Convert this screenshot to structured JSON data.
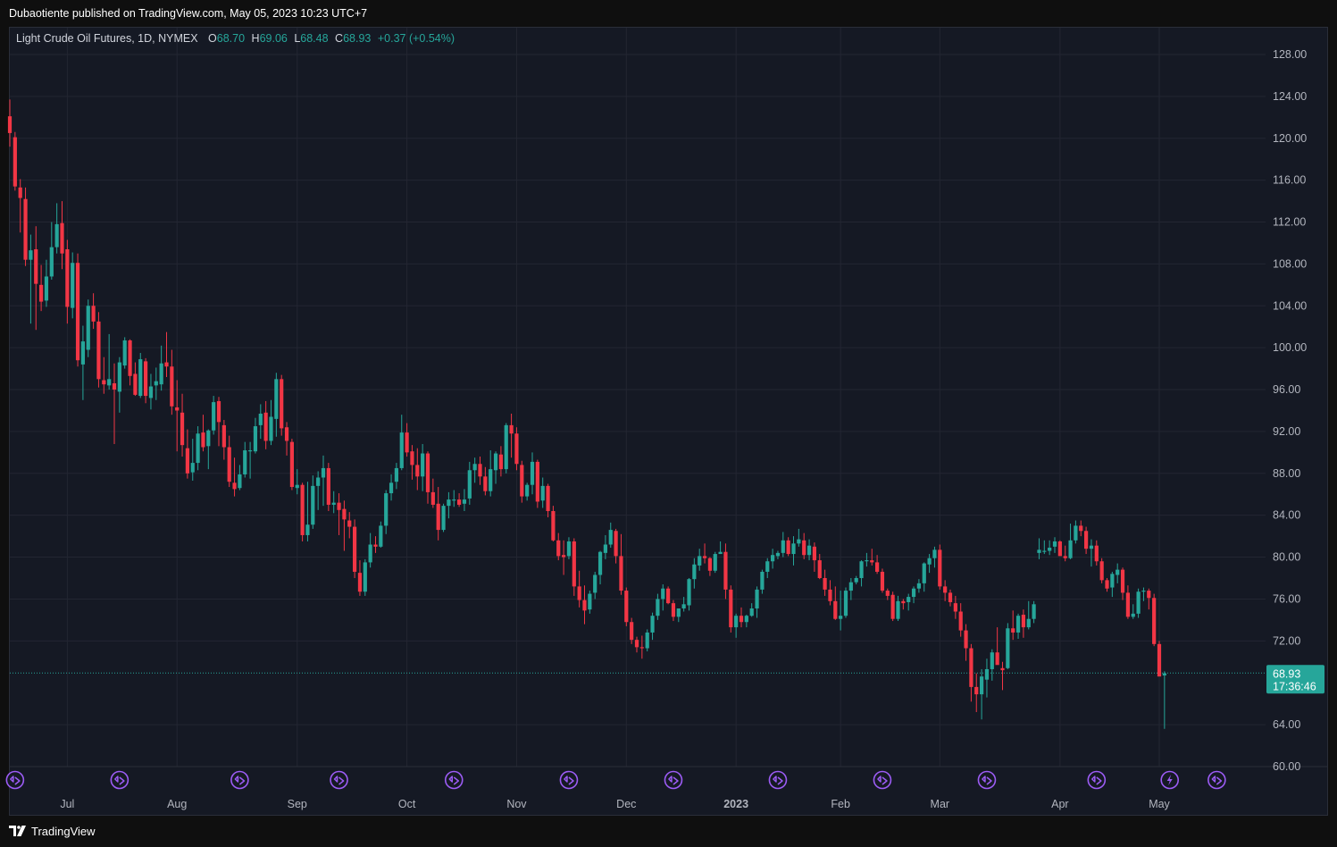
{
  "header": {
    "published_line": "Dubaotiente published on TradingView.com, May 05, 2023 10:23 UTC+7"
  },
  "legend": {
    "symbol": "Light Crude Oil Futures, 1D, NYMEX",
    "open_label": "O",
    "open": "68.70",
    "high_label": "H",
    "high": "69.06",
    "low_label": "L",
    "low": "68.48",
    "close_label": "C",
    "close": "68.93",
    "change": "+0.37 (+0.54%)"
  },
  "price_tag": {
    "price": "68.93",
    "countdown": "17:36:46"
  },
  "footer": {
    "brand": "TradingView"
  },
  "colors": {
    "up": "#26a69a",
    "down": "#f23645",
    "background": "#151924",
    "grid": "#232632",
    "axis_text": "#b2b5be",
    "event_icon": "#9c5cf5"
  },
  "icons": [
    "dividend-event-icon",
    "flash-event-icon",
    "tradingview-logo-icon"
  ],
  "chart_data": {
    "type": "candlestick",
    "title": "Light Crude Oil Futures, 1D, NYMEX",
    "xlabel": "",
    "ylabel": "",
    "ylim": [
      60,
      128
    ],
    "y_ticks": [
      "128.00",
      "124.00",
      "120.00",
      "116.00",
      "112.00",
      "108.00",
      "104.00",
      "100.00",
      "96.00",
      "92.00",
      "88.00",
      "84.00",
      "80.00",
      "76.00",
      "72.00",
      "64.00",
      "60.00"
    ],
    "x_ticks": [
      {
        "label": "Jul",
        "index": 11
      },
      {
        "label": "Aug",
        "index": 32
      },
      {
        "label": "Sep",
        "index": 55
      },
      {
        "label": "Oct",
        "index": 76
      },
      {
        "label": "Nov",
        "index": 97
      },
      {
        "label": "Dec",
        "index": 118
      },
      {
        "label": "2023",
        "index": 139
      },
      {
        "label": "Feb",
        "index": 159
      },
      {
        "label": "Mar",
        "index": 178
      },
      {
        "label": "Apr",
        "index": 201
      },
      {
        "label": "May",
        "index": 220
      }
    ],
    "grid": true,
    "last_price_line": 68.93,
    "ohlc": [
      [
        122.1,
        123.7,
        119.2,
        120.5
      ],
      [
        120.1,
        120.6,
        115.0,
        115.4
      ],
      [
        115.3,
        116.1,
        111.0,
        114.3
      ],
      [
        114.2,
        115.3,
        107.8,
        108.4
      ],
      [
        108.4,
        110.8,
        102.3,
        109.3
      ],
      [
        109.4,
        111.6,
        101.7,
        106.1
      ],
      [
        106.0,
        107.9,
        103.5,
        104.4
      ],
      [
        104.5,
        108.4,
        103.9,
        106.8
      ],
      [
        106.8,
        112.0,
        106.5,
        109.6
      ],
      [
        109.6,
        113.8,
        109.0,
        111.8
      ],
      [
        111.9,
        114.0,
        107.5,
        109.0
      ],
      [
        109.4,
        110.3,
        102.3,
        103.9
      ],
      [
        103.8,
        109.1,
        102.8,
        108.1
      ],
      [
        108.1,
        109.0,
        98.2,
        98.8
      ],
      [
        98.4,
        102.1,
        95.0,
        100.6
      ],
      [
        99.8,
        104.6,
        99.1,
        104.0
      ],
      [
        104.0,
        105.2,
        101.8,
        102.5
      ],
      [
        102.5,
        103.4,
        96.2,
        97.0
      ],
      [
        96.9,
        99.1,
        95.6,
        96.5
      ],
      [
        96.4,
        101.3,
        96.0,
        97.0
      ],
      [
        96.6,
        98.5,
        90.8,
        96.0
      ],
      [
        95.8,
        99.1,
        93.8,
        98.6
      ],
      [
        98.3,
        101.0,
        98.0,
        100.7
      ],
      [
        100.7,
        100.8,
        96.4,
        97.3
      ],
      [
        97.5,
        98.6,
        95.4,
        95.5
      ],
      [
        95.4,
        99.5,
        95.2,
        98.9
      ],
      [
        98.7,
        99.0,
        94.7,
        95.4
      ],
      [
        95.2,
        97.5,
        94.1,
        96.3
      ],
      [
        96.4,
        98.1,
        95.0,
        96.8
      ],
      [
        96.5,
        100.2,
        95.9,
        98.5
      ],
      [
        98.6,
        101.5,
        97.2,
        98.2
      ],
      [
        98.2,
        99.8,
        93.6,
        94.4
      ],
      [
        94.3,
        96.9,
        90.1,
        94.0
      ],
      [
        93.8,
        95.6,
        89.6,
        90.7
      ],
      [
        90.4,
        92.2,
        87.5,
        88.0
      ],
      [
        88.1,
        91.3,
        87.3,
        89.0
      ],
      [
        89.0,
        92.5,
        88.3,
        91.8
      ],
      [
        91.9,
        93.6,
        90.1,
        90.5
      ],
      [
        90.6,
        92.2,
        88.4,
        92.1
      ],
      [
        92.1,
        95.4,
        91.7,
        94.8
      ],
      [
        94.9,
        95.3,
        90.6,
        92.9
      ],
      [
        92.6,
        93.1,
        89.3,
        90.5
      ],
      [
        90.5,
        91.6,
        86.7,
        87.2
      ],
      [
        87.1,
        89.5,
        85.8,
        86.5
      ],
      [
        86.6,
        88.8,
        86.4,
        87.9
      ],
      [
        87.9,
        91.0,
        87.6,
        90.2
      ],
      [
        90.1,
        91.0,
        87.5,
        90.2
      ],
      [
        90.1,
        93.3,
        89.9,
        92.5
      ],
      [
        92.6,
        94.6,
        91.3,
        93.7
      ],
      [
        93.8,
        94.9,
        90.3,
        91.1
      ],
      [
        91.1,
        95.0,
        90.7,
        93.4
      ],
      [
        93.2,
        97.6,
        91.5,
        97.0
      ],
      [
        97.0,
        97.4,
        91.6,
        92.3
      ],
      [
        92.4,
        92.9,
        89.7,
        91.1
      ],
      [
        91.0,
        91.3,
        86.4,
        86.7
      ],
      [
        86.6,
        88.4,
        86.0,
        86.9
      ],
      [
        86.9,
        87.1,
        81.5,
        82.1
      ],
      [
        82.1,
        87.2,
        81.5,
        83.1
      ],
      [
        83.1,
        87.8,
        82.7,
        86.8
      ],
      [
        86.8,
        88.2,
        84.5,
        87.6
      ],
      [
        87.6,
        89.7,
        84.9,
        88.5
      ],
      [
        88.5,
        89.0,
        84.4,
        85.0
      ],
      [
        85.0,
        86.3,
        84.2,
        85.2
      ],
      [
        85.2,
        86.1,
        82.1,
        84.5
      ],
      [
        84.6,
        85.4,
        80.6,
        83.6
      ],
      [
        83.5,
        84.3,
        81.8,
        82.9
      ],
      [
        82.9,
        83.6,
        78.0,
        78.6
      ],
      [
        78.5,
        79.7,
        76.3,
        76.7
      ],
      [
        76.7,
        79.8,
        76.3,
        79.5
      ],
      [
        79.5,
        82.3,
        79.0,
        81.2
      ],
      [
        81.2,
        82.0,
        80.4,
        81.0
      ],
      [
        81.0,
        83.4,
        80.9,
        83.0
      ],
      [
        83.0,
        86.4,
        82.2,
        86.1
      ],
      [
        86.1,
        87.9,
        85.4,
        87.1
      ],
      [
        87.2,
        89.0,
        86.5,
        88.5
      ],
      [
        88.5,
        93.6,
        88.3,
        91.9
      ],
      [
        91.9,
        92.8,
        89.6,
        90.0
      ],
      [
        90.1,
        90.7,
        87.4,
        88.8
      ],
      [
        88.8,
        90.4,
        86.4,
        87.7
      ],
      [
        87.7,
        90.8,
        86.3,
        89.9
      ],
      [
        89.9,
        90.1,
        85.1,
        86.2
      ],
      [
        86.2,
        87.5,
        84.7,
        85.0
      ],
      [
        85.1,
        86.7,
        81.6,
        82.6
      ],
      [
        82.6,
        85.1,
        82.4,
        84.9
      ],
      [
        84.9,
        86.2,
        83.7,
        85.5
      ],
      [
        85.4,
        86.4,
        84.8,
        85.5
      ],
      [
        85.5,
        86.1,
        84.8,
        85.0
      ],
      [
        85.1,
        86.5,
        84.4,
        85.5
      ],
      [
        85.6,
        89.1,
        85.0,
        88.3
      ],
      [
        88.3,
        89.5,
        87.1,
        88.9
      ],
      [
        88.9,
        89.6,
        86.9,
        87.7
      ],
      [
        87.7,
        88.6,
        85.9,
        86.3
      ],
      [
        86.3,
        90.2,
        85.8,
        88.4
      ],
      [
        88.3,
        90.1,
        87.0,
        89.9
      ],
      [
        89.8,
        90.6,
        87.7,
        88.4
      ],
      [
        88.4,
        92.8,
        88.0,
        92.6
      ],
      [
        92.6,
        93.7,
        89.5,
        91.8
      ],
      [
        91.8,
        92.4,
        88.3,
        88.9
      ],
      [
        88.8,
        89.2,
        85.2,
        85.8
      ],
      [
        85.8,
        87.1,
        85.4,
        86.9
      ],
      [
        86.9,
        90.0,
        86.0,
        89.1
      ],
      [
        89.1,
        89.3,
        84.7,
        85.3
      ],
      [
        85.4,
        87.6,
        84.7,
        86.8
      ],
      [
        86.8,
        87.0,
        83.8,
        84.4
      ],
      [
        84.4,
        84.9,
        81.5,
        81.6
      ],
      [
        81.6,
        82.3,
        79.7,
        80.1
      ],
      [
        80.2,
        81.6,
        78.3,
        80.0
      ],
      [
        80.1,
        81.9,
        79.8,
        81.5
      ],
      [
        81.5,
        81.8,
        76.3,
        77.2
      ],
      [
        77.2,
        78.7,
        75.2,
        75.9
      ],
      [
        75.9,
        77.3,
        73.6,
        74.9
      ],
      [
        75.0,
        76.8,
        74.6,
        76.5
      ],
      [
        76.6,
        78.6,
        76.0,
        78.3
      ],
      [
        78.3,
        80.6,
        77.4,
        80.5
      ],
      [
        80.4,
        82.1,
        79.8,
        81.2
      ],
      [
        81.2,
        83.3,
        80.9,
        82.6
      ],
      [
        82.5,
        82.7,
        79.4,
        80.1
      ],
      [
        80.1,
        82.2,
        76.4,
        76.8
      ],
      [
        76.8,
        77.1,
        73.4,
        73.8
      ],
      [
        73.8,
        74.2,
        71.7,
        72.1
      ],
      [
        72.1,
        72.4,
        70.9,
        71.4
      ],
      [
        71.4,
        72.5,
        70.3,
        71.3
      ],
      [
        71.3,
        73.1,
        71.0,
        72.8
      ],
      [
        72.8,
        74.7,
        72.1,
        74.4
      ],
      [
        74.4,
        76.5,
        74.0,
        76.0
      ],
      [
        76.0,
        77.4,
        74.9,
        77.0
      ],
      [
        77.0,
        77.2,
        75.5,
        75.6
      ],
      [
        75.6,
        75.9,
        73.9,
        74.3
      ],
      [
        74.3,
        75.1,
        73.8,
        75.1
      ],
      [
        75.1,
        76.2,
        74.8,
        75.5
      ],
      [
        75.4,
        78.0,
        74.9,
        77.9
      ],
      [
        77.9,
        79.9,
        77.0,
        79.3
      ],
      [
        79.2,
        80.8,
        78.7,
        80.1
      ],
      [
        80.1,
        81.3,
        79.4,
        79.9
      ],
      [
        79.9,
        80.0,
        78.2,
        78.7
      ],
      [
        78.7,
        80.5,
        78.5,
        80.3
      ],
      [
        80.3,
        81.5,
        80.3,
        80.5
      ],
      [
        80.5,
        81.3,
        76.0,
        76.9
      ],
      [
        76.9,
        77.3,
        72.8,
        73.3
      ],
      [
        73.3,
        74.6,
        72.3,
        74.4
      ],
      [
        74.4,
        75.2,
        73.3,
        73.8
      ],
      [
        73.8,
        74.5,
        73.3,
        74.4
      ],
      [
        74.4,
        75.6,
        74.3,
        75.1
      ],
      [
        75.1,
        77.2,
        74.2,
        76.9
      ],
      [
        76.9,
        78.8,
        76.5,
        78.6
      ],
      [
        78.6,
        79.9,
        78.0,
        79.6
      ],
      [
        79.6,
        80.8,
        78.9,
        80.2
      ],
      [
        80.1,
        80.6,
        79.8,
        80.4
      ],
      [
        80.4,
        82.4,
        80.0,
        81.6
      ],
      [
        81.6,
        81.9,
        80.1,
        80.3
      ],
      [
        80.3,
        82.0,
        79.2,
        81.3
      ],
      [
        81.3,
        82.7,
        81.0,
        81.7
      ],
      [
        81.6,
        82.3,
        79.8,
        80.2
      ],
      [
        80.2,
        81.7,
        79.7,
        81.1
      ],
      [
        81.0,
        81.4,
        78.6,
        79.7
      ],
      [
        79.7,
        80.3,
        77.9,
        78.0
      ],
      [
        78.0,
        78.8,
        76.3,
        76.9
      ],
      [
        76.9,
        77.8,
        75.4,
        75.8
      ],
      [
        75.8,
        77.2,
        74.0,
        74.1
      ],
      [
        74.1,
        76.8,
        73.0,
        74.4
      ],
      [
        74.4,
        77.1,
        74.2,
        76.8
      ],
      [
        76.8,
        78.0,
        75.9,
        77.6
      ],
      [
        77.6,
        78.2,
        77.4,
        78.0
      ],
      [
        78.0,
        79.7,
        77.2,
        79.6
      ],
      [
        79.6,
        80.4,
        79.1,
        79.7
      ],
      [
        79.7,
        80.8,
        79.2,
        79.5
      ],
      [
        79.5,
        80.2,
        78.4,
        78.6
      ],
      [
        78.6,
        78.9,
        76.6,
        76.8
      ],
      [
        76.8,
        77.0,
        75.9,
        76.3
      ],
      [
        76.4,
        76.7,
        73.9,
        74.1
      ],
      [
        74.1,
        76.3,
        73.9,
        75.8
      ],
      [
        75.8,
        76.0,
        75.0,
        75.6
      ],
      [
        75.7,
        76.5,
        74.9,
        76.2
      ],
      [
        76.2,
        77.2,
        75.6,
        77.0
      ],
      [
        77.0,
        77.9,
        76.6,
        77.5
      ],
      [
        77.5,
        79.5,
        76.7,
        79.4
      ],
      [
        79.3,
        80.3,
        78.5,
        79.9
      ],
      [
        79.9,
        81.0,
        79.0,
        80.7
      ],
      [
        80.7,
        81.2,
        76.9,
        77.2
      ],
      [
        77.2,
        77.8,
        75.8,
        76.6
      ],
      [
        76.6,
        76.9,
        75.3,
        75.7
      ],
      [
        75.6,
        76.3,
        74.1,
        74.8
      ],
      [
        74.8,
        75.6,
        72.4,
        73.0
      ],
      [
        73.0,
        73.6,
        70.1,
        71.3
      ],
      [
        71.3,
        71.7,
        66.2,
        67.6
      ],
      [
        67.6,
        68.9,
        65.2,
        66.9
      ],
      [
        66.9,
        69.3,
        64.5,
        68.6
      ],
      [
        68.3,
        70.3,
        66.6,
        69.3
      ],
      [
        69.3,
        71.2,
        68.2,
        70.9
      ],
      [
        70.9,
        73.3,
        69.8,
        69.7
      ],
      [
        69.4,
        70.0,
        67.3,
        69.2
      ],
      [
        69.4,
        73.7,
        69.3,
        73.2
      ],
      [
        73.2,
        74.9,
        72.1,
        72.8
      ],
      [
        72.8,
        74.6,
        72.2,
        74.4
      ],
      [
        74.5,
        75.0,
        72.3,
        73.3
      ],
      [
        73.3,
        75.8,
        73.1,
        74.1
      ],
      [
        74.1,
        75.8,
        73.7,
        75.5
      ],
      [
        80.4,
        81.8,
        79.8,
        80.7
      ],
      [
        80.5,
        81.6,
        80.3,
        80.6
      ],
      [
        80.6,
        81.6,
        80.2,
        80.9
      ],
      [
        81.0,
        81.9,
        80.4,
        81.5
      ],
      [
        81.5,
        81.6,
        80.3,
        80.1
      ],
      [
        80.1,
        81.1,
        79.6,
        79.9
      ],
      [
        79.9,
        83.2,
        79.8,
        81.6
      ],
      [
        81.6,
        83.5,
        81.3,
        83.0
      ],
      [
        83.0,
        83.5,
        82.0,
        82.5
      ],
      [
        82.5,
        82.9,
        80.3,
        80.8
      ],
      [
        80.8,
        81.7,
        79.1,
        81.1
      ],
      [
        81.1,
        81.6,
        79.2,
        79.6
      ],
      [
        79.6,
        79.9,
        77.5,
        77.8
      ],
      [
        77.8,
        78.0,
        76.7,
        77.0
      ],
      [
        77.1,
        78.6,
        76.2,
        78.4
      ],
      [
        78.3,
        79.4,
        77.5,
        78.8
      ],
      [
        78.8,
        79.0,
        75.9,
        76.6
      ],
      [
        76.6,
        77.3,
        74.1,
        74.3
      ],
      [
        74.3,
        75.5,
        74.1,
        74.6
      ],
      [
        74.6,
        77.0,
        74.2,
        76.7
      ],
      [
        76.7,
        77.1,
        75.8,
        76.8
      ],
      [
        76.8,
        77.0,
        75.0,
        76.1
      ],
      [
        76.1,
        76.5,
        71.5,
        71.7
      ],
      [
        71.7,
        72.0,
        68.7,
        68.6
      ],
      [
        68.7,
        69.1,
        63.6,
        68.9
      ]
    ],
    "event_markers": {
      "dividend_indices": [
        1,
        21,
        44,
        63,
        85,
        107,
        127,
        147,
        167,
        187,
        208,
        231
      ],
      "flash_indices": [
        222
      ]
    }
  }
}
